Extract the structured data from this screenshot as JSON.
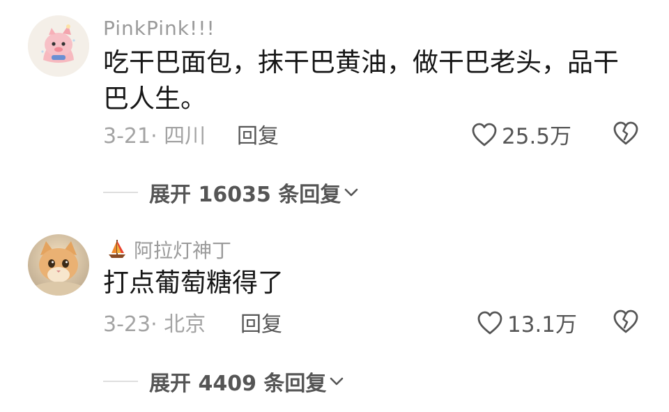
{
  "comments": [
    {
      "username": "PinkPink!!!",
      "avatar_icon": "pink-cartoon-pig-avatar",
      "text": "吃干巴面包，抹干巴黄油，做干巴老头，品干巴人生。",
      "date_location": "3-21· 四川",
      "reply_label": "回复",
      "likes": "25.5万",
      "expand_replies": "展开 16035 条回复"
    },
    {
      "username": "阿拉灯神丁",
      "username_prefix_icon": "sailboat-icon",
      "avatar_icon": "orange-cat-avatar",
      "text": "打点葡萄糖得了",
      "date_location": "3-23· 北京",
      "reply_label": "回复",
      "likes": "13.1万",
      "expand_replies": "展开 4409 条回复"
    }
  ],
  "icons": {
    "like": "heart-outline-icon",
    "dislike": "broken-heart-icon",
    "expand": "chevron-down-icon"
  },
  "colors": {
    "username": "#9a9a9a",
    "body": "#161616",
    "meta": "#a3a3a3",
    "action": "#555555"
  }
}
